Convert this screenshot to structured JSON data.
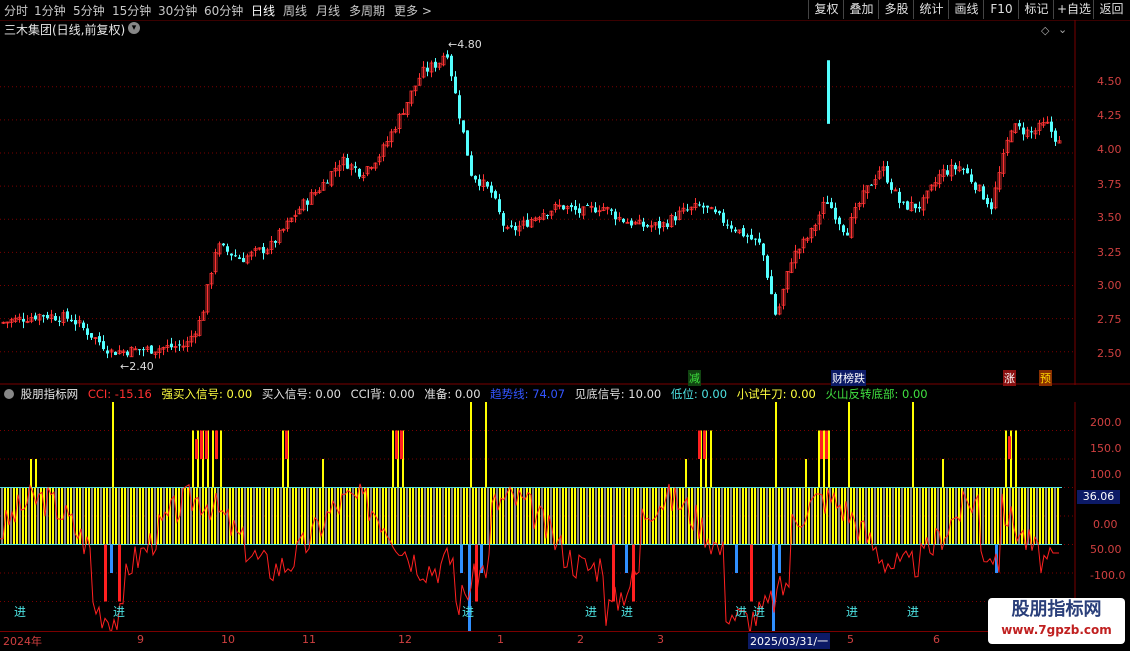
{
  "toolbar": {
    "timeframes": [
      "分时",
      "1分钟",
      "5分钟",
      "15分钟",
      "30分钟",
      "60分钟",
      "日线",
      "周线",
      "月线",
      "多周期",
      "更多 >"
    ],
    "active": "日线",
    "right_buttons": [
      "复权",
      "叠加",
      "多股",
      "统计",
      "画线",
      "F10",
      "标记",
      "+自选",
      "返回"
    ]
  },
  "main_chart": {
    "title": "三木集团(日线,前复权)",
    "high_mark": "4.80",
    "low_mark": "2.40",
    "price_axis": [
      "4.50",
      "4.25",
      "4.00",
      "3.75",
      "3.50",
      "3.25",
      "3.00",
      "2.75",
      "2.50"
    ],
    "event_tags": [
      {
        "text": "减",
        "color": "#3ee03e"
      },
      {
        "text": "财榜跌",
        "color": "#ffffff"
      },
      {
        "text": "涨",
        "color": "#ffffff"
      },
      {
        "text": "预",
        "color": "#ffd700"
      }
    ]
  },
  "indicator": {
    "name": "股朋指标网",
    "legend": [
      {
        "text": "CCI: -15.16",
        "color": "#ff3030"
      },
      {
        "text": "强买入信号: 0.00",
        "color": "#ffff40"
      },
      {
        "text": "买入信号: 0.00",
        "color": "#e0e0e0"
      },
      {
        "text": "CCI背: 0.00",
        "color": "#e0e0e0"
      },
      {
        "text": "准备: 0.00",
        "color": "#e0e0e0"
      },
      {
        "text": "趋势线: 74.07",
        "color": "#3355ff"
      },
      {
        "text": "见底信号: 10.00",
        "color": "#e0e0e0"
      },
      {
        "text": "低位: 0.00",
        "color": "#4de1e1"
      },
      {
        "text": "小试牛刀: 0.00",
        "color": "#ffff40"
      },
      {
        "text": "火山反转底部: 0.00",
        "color": "#40e040"
      }
    ],
    "axis": [
      "200.0",
      "150.0",
      "100.0",
      "50.00",
      "0.00",
      "-50.00",
      "-100.0"
    ],
    "current_value": "36.06",
    "entry_labels": [
      "进",
      "进",
      "进",
      "进",
      "进",
      "进",
      "进",
      "进",
      "进",
      "进"
    ]
  },
  "date_axis": [
    "2024年",
    "9",
    "10",
    "11",
    "12",
    "1",
    "2",
    "3",
    "2025/03/31/一",
    "5",
    "6"
  ],
  "watermark": {
    "line1": "股朋指标网",
    "line2": "www.7gpzb.com"
  },
  "colors": {
    "up": "#ff3333",
    "down": "#54ffff",
    "grid": "#7a0000",
    "fill": "#ffff00"
  },
  "chart_data": {
    "type": "candlestick",
    "title": "三木集团(日线,前复权)",
    "x_range": [
      "2024-07",
      "2025-06"
    ],
    "ylim": [
      2.4,
      4.8
    ],
    "price_path": [
      [
        0,
        2.72
      ],
      [
        40,
        2.78
      ],
      [
        70,
        2.75
      ],
      [
        110,
        2.5
      ],
      [
        150,
        2.52
      ],
      [
        185,
        2.55
      ],
      [
        200,
        2.75
      ],
      [
        215,
        3.3
      ],
      [
        240,
        3.2
      ],
      [
        270,
        3.3
      ],
      [
        300,
        3.6
      ],
      [
        320,
        3.75
      ],
      [
        340,
        3.95
      ],
      [
        360,
        3.85
      ],
      [
        380,
        4.0
      ],
      [
        400,
        4.3
      ],
      [
        420,
        4.6
      ],
      [
        440,
        4.7
      ],
      [
        445,
        4.8
      ],
      [
        455,
        4.4
      ],
      [
        470,
        3.85
      ],
      [
        490,
        3.7
      ],
      [
        505,
        3.4
      ],
      [
        520,
        3.45
      ],
      [
        540,
        3.55
      ],
      [
        560,
        3.6
      ],
      [
        580,
        3.55
      ],
      [
        600,
        3.6
      ],
      [
        620,
        3.5
      ],
      [
        640,
        3.45
      ],
      [
        660,
        3.45
      ],
      [
        680,
        3.55
      ],
      [
        700,
        3.6
      ],
      [
        720,
        3.5
      ],
      [
        740,
        3.4
      ],
      [
        760,
        3.3
      ],
      [
        775,
        2.75
      ],
      [
        790,
        3.2
      ],
      [
        810,
        3.4
      ],
      [
        825,
        3.65
      ],
      [
        845,
        3.4
      ],
      [
        860,
        3.65
      ],
      [
        880,
        3.9
      ],
      [
        900,
        3.6
      ],
      [
        920,
        3.6
      ],
      [
        940,
        3.85
      ],
      [
        960,
        3.9
      ],
      [
        975,
        3.75
      ],
      [
        990,
        3.6
      ],
      [
        1010,
        4.2
      ],
      [
        1030,
        4.15
      ],
      [
        1045,
        4.22
      ],
      [
        1060,
        4.05
      ]
    ],
    "indicator_series": {
      "name": "CCI",
      "ylim": [
        -150,
        250
      ],
      "fill_level": 100,
      "zero_line": 0
    }
  }
}
